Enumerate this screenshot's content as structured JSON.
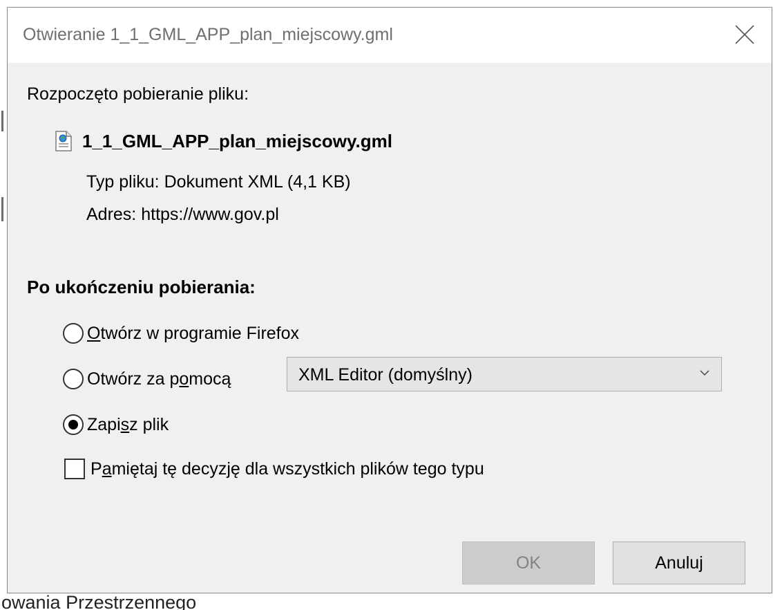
{
  "window": {
    "title": "Otwieranie 1_1_GML_APP_plan_miejscowy.gml"
  },
  "download": {
    "intro": "Rozpoczęto pobieranie pliku:",
    "file_name": "1_1_GML_APP_plan_miejscowy.gml",
    "file_icon": "xml-document-icon",
    "type_label": "Typ pliku:",
    "type_value": "Dokument XML (4,1 KB)",
    "address_label": "Adres:",
    "address_value": "https://www.gov.pl"
  },
  "after_download": {
    "heading": "Po ukończeniu pobierania:",
    "options": [
      {
        "label_pre": "",
        "label_key": "O",
        "label_post": "twórz w programie Firefox",
        "selected": false
      },
      {
        "label_pre": "Otwórz za p",
        "label_key": "o",
        "label_post": "mocą",
        "selected": false
      },
      {
        "label_pre": "Zapi",
        "label_key": "s",
        "label_post": "z plik",
        "selected": true
      }
    ],
    "open_with_select": {
      "selected": "XML Editor (domyślny)"
    },
    "remember": {
      "label_pre": "P",
      "label_key": "a",
      "label_post": "miętaj tę decyzję dla wszystkich plików tego typu",
      "checked": false
    }
  },
  "buttons": {
    "ok_label": "OK",
    "ok_enabled": false,
    "cancel_label": "Anuluj"
  },
  "background": {
    "bottom_text": "owania Przestrzennego"
  },
  "colors": {
    "dialog_bg": "#f0f0f0",
    "titlebar_bg": "#ffffff",
    "title_text": "#6f6f6f",
    "button_bg": "#e1e1e1",
    "button_disabled_bg": "#cccccc"
  }
}
